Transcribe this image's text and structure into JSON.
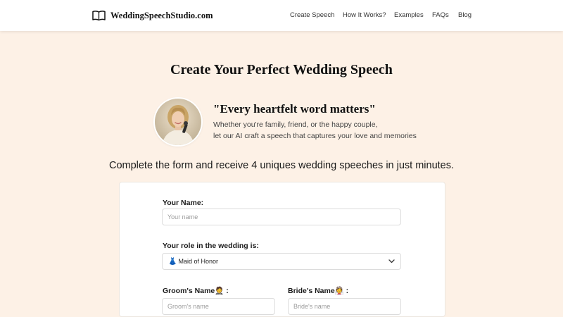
{
  "header": {
    "logo_text": "WeddingSpeechStudio.com",
    "logo_icon": "open-book-icon",
    "nav": [
      "Create Speech",
      "How It Works?",
      "Examples",
      "FAQs",
      "Blog"
    ]
  },
  "main": {
    "title": "Create Your Perfect Wedding Speech",
    "quote": "\"Every heartfelt word matters\"",
    "quote_lines": [
      "Whether you're family, friend, or the happy couple,",
      "let our AI craft a speech that captures your love and memories"
    ],
    "tagline": "Complete the form and receive 4 uniques wedding speeches in just minutes."
  },
  "form": {
    "name_label": "Your Name:",
    "name_placeholder": "Your name",
    "role_label": "Your role in the wedding is:",
    "role_emoji": "👗",
    "role_value": "Maid of Honor",
    "groom_label": "Groom's Name🤵 :",
    "groom_placeholder": "Groom's name",
    "bride_label": "Bride's Name👰 :",
    "bride_placeholder": "Bride's name"
  },
  "colors": {
    "background": "#fdf1e6",
    "header": "#ffffff",
    "card": "#ffffff"
  }
}
